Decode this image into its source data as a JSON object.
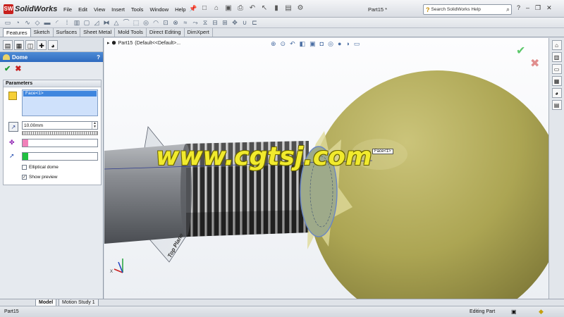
{
  "app": {
    "logo_mark": "SW",
    "name": "SolidWorks",
    "doc_title": "Part15 *"
  },
  "menu": [
    "File",
    "Edit",
    "View",
    "Insert",
    "Tools",
    "Window",
    "Help"
  ],
  "search": {
    "placeholder": "Search SolidWorks Help"
  },
  "tabs": [
    "Features",
    "Sketch",
    "Surfaces",
    "Sheet Metal",
    "Mold Tools",
    "Direct Editing",
    "DimXpert"
  ],
  "tree": {
    "part": "Part15",
    "config": "(Default<<Default>..."
  },
  "property_manager": {
    "title": "Dome",
    "help": "?",
    "group_title": "Parameters",
    "face_item": "Face<1>",
    "distance": "10.00mm",
    "elliptical_label": "Elliptical dome",
    "preview_label": "Show preview",
    "preview_checked": "✓"
  },
  "viewport": {
    "face_tag": "Face<1>",
    "plane_label": "Top Plane",
    "watermark": "www.cgtsj.com"
  },
  "bottom_tabs": [
    "Model",
    "Motion Study 1"
  ],
  "status": {
    "left": "Part15",
    "right": "Editing Part"
  },
  "colors": {
    "dome": "#b3ac5a",
    "accent": "#3f86de",
    "watermark": "#f1ea2d"
  }
}
